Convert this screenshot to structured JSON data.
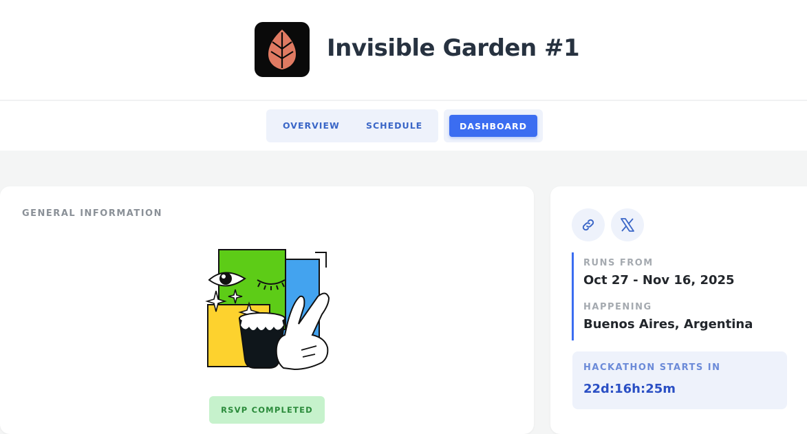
{
  "header": {
    "title": "Invisible Garden #1",
    "logo_icon": "leaf-icon",
    "logo_color": "#e07a62"
  },
  "nav": {
    "tabs": [
      {
        "label": "OVERVIEW"
      },
      {
        "label": "SCHEDULE"
      },
      {
        "label": "DASHBOARD"
      }
    ],
    "active_tab": "DASHBOARD",
    "accent": "#3b6df1"
  },
  "general": {
    "section_label": "GENERAL INFORMATION",
    "rsvp_status": "RSVP COMPLETED"
  },
  "sidebar": {
    "links": [
      {
        "icon": "link-icon"
      },
      {
        "icon": "x-logo-icon"
      }
    ],
    "runs_from_label": "RUNS FROM",
    "runs_from_value": "Oct 27 - Nov 16, 2025",
    "happening_label": "HAPPENING",
    "happening_value": "Buenos Aires, Argentina",
    "countdown_label": "HACKATHON STARTS IN",
    "countdown_value": "22d:16h:25m"
  }
}
